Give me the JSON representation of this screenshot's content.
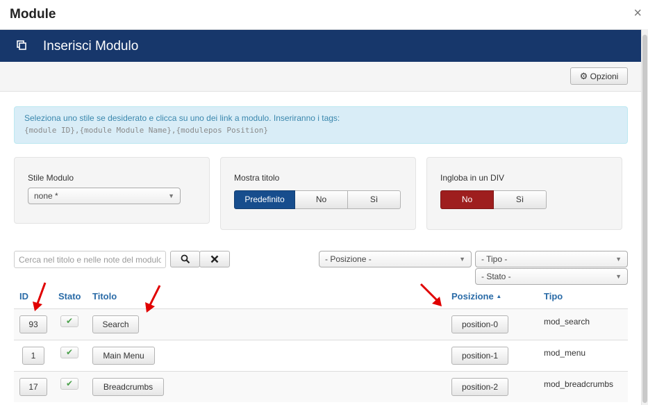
{
  "modal": {
    "title": "Module",
    "close": "×"
  },
  "header": {
    "title": "Inserisci Modulo"
  },
  "toolbar": {
    "options_label": "Opzioni"
  },
  "info": {
    "line1": "Seleziona uno stile se desiderato e clicca su uno dei link a modulo. Inseriranno i tags:",
    "line2": "{module ID},{module Module Name},{modulepos Position}"
  },
  "style_panel": {
    "label": "Stile Modulo",
    "selected": "none *"
  },
  "title_panel": {
    "label": "Mostra titolo",
    "options": [
      "Predefinito",
      "No",
      "Sì"
    ],
    "active": "Predefinito"
  },
  "div_panel": {
    "label": "Ingloba in un DIV",
    "options": [
      "No",
      "Sì"
    ],
    "active": "No"
  },
  "filters": {
    "search_placeholder": "Cerca nel titolo e nelle note del modulo",
    "position": "- Posizione -",
    "type": "- Tipo -",
    "state": "- Stato -"
  },
  "table": {
    "headers": {
      "id": "ID",
      "state": "Stato",
      "title": "Titolo",
      "position": "Posizione",
      "sort_icon": "▲",
      "type": "Tipo"
    },
    "rows": [
      {
        "id": "93",
        "title": "Search",
        "position": "position-0",
        "type": "mod_search"
      },
      {
        "id": "1",
        "title": "Main Menu",
        "position": "position-1",
        "type": "mod_menu"
      },
      {
        "id": "17",
        "title": "Breadcrumbs",
        "position": "position-2",
        "type": "mod_breadcrumbs"
      }
    ]
  },
  "colors": {
    "header_bar": "#17376b",
    "active_blue": "#174d8d",
    "active_red": "#9e1e1e",
    "link": "#2a6ba7",
    "annotation_arrow": "#e00000"
  },
  "icons": [
    "modal-close-icon",
    "insert-module-icon",
    "gear-icon",
    "search-icon",
    "clear-icon",
    "check-icon",
    "annotation-arrow-icon"
  ]
}
